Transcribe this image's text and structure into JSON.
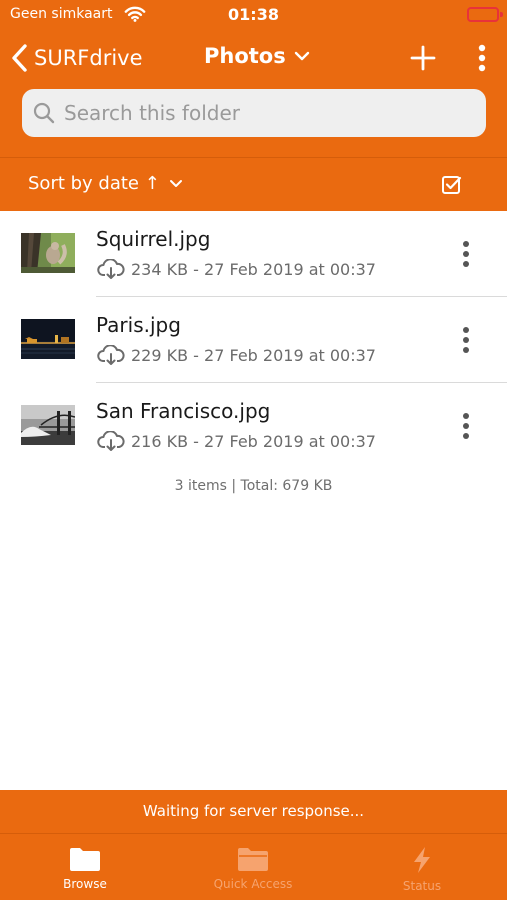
{
  "status_bar": {
    "carrier": "Geen simkaart",
    "time": "01:38"
  },
  "nav": {
    "back_label": "SURFdrive",
    "title": "Photos"
  },
  "search": {
    "placeholder": "Search this folder"
  },
  "sort": {
    "label": "Sort by date ↑"
  },
  "files": [
    {
      "name": "Squirrel.jpg",
      "meta": "234 KB - 27 Feb 2019 at 00:37"
    },
    {
      "name": "Paris.jpg",
      "meta": "229 KB - 27 Feb 2019 at 00:37"
    },
    {
      "name": "San Francisco.jpg",
      "meta": "216 KB - 27 Feb 2019 at 00:37"
    }
  ],
  "summary": "3 items | Total: 679 KB",
  "server_status": "Waiting for server response...",
  "tabs": [
    {
      "label": "Browse",
      "active": true
    },
    {
      "label": "Quick Access",
      "active": false
    },
    {
      "label": "Status",
      "active": false
    }
  ],
  "colors": {
    "accent": "#ea6a10",
    "battery_low": "#e8323a",
    "tab_inactive": "#f6a36e"
  }
}
